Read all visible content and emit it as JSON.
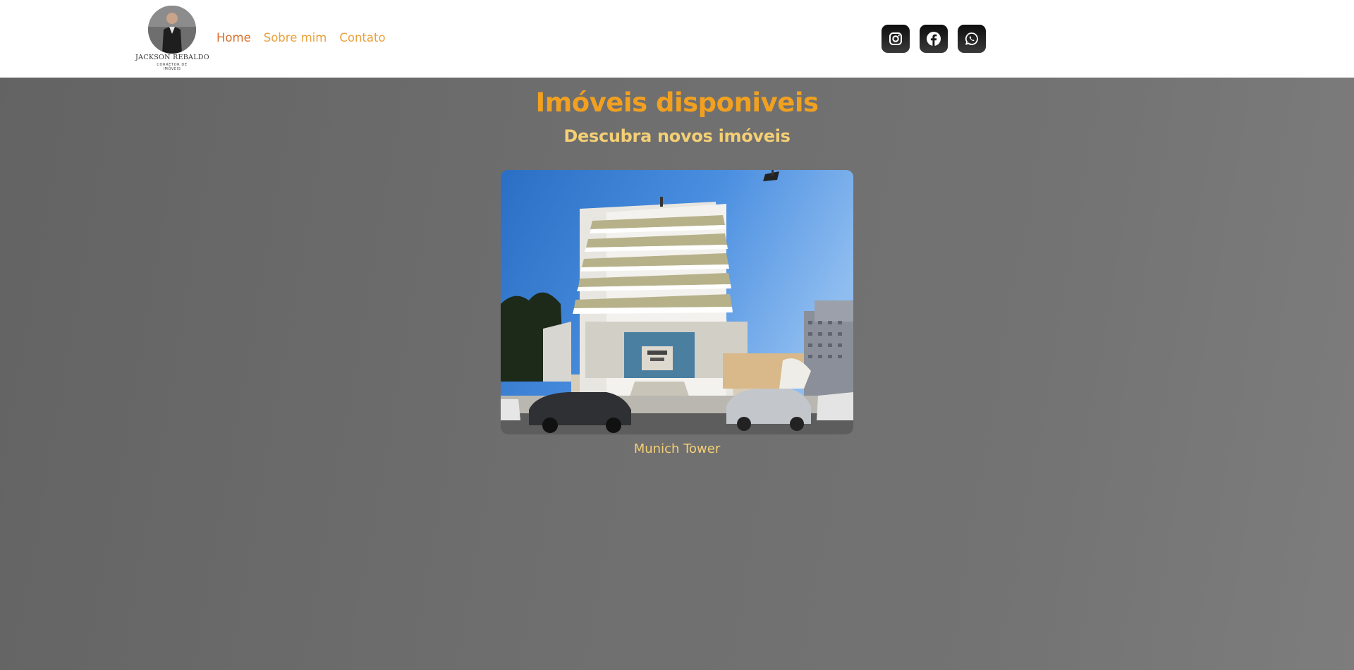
{
  "header": {
    "logo": {
      "name": "JACKSON REBALDO",
      "subtitle_line1": "CORRETOR DE",
      "subtitle_line2": "IMÓVEIS"
    },
    "nav": [
      {
        "label": "Home",
        "active": true
      },
      {
        "label": "Sobre mim",
        "active": false
      },
      {
        "label": "Contato",
        "active": false
      }
    ],
    "socials": [
      "instagram-icon",
      "facebook-icon",
      "whatsapp-icon"
    ]
  },
  "main": {
    "title": "Imóveis disponiveis",
    "subtitle": "Descubra novos imóveis",
    "listings": [
      {
        "name": "Munich Tower"
      }
    ]
  },
  "colors": {
    "accent": "#f1a020",
    "nav_active": "#d9702b",
    "nav_link": "#eaa13c",
    "subtitle": "#f4cf74",
    "background": "#6f6f6f"
  }
}
